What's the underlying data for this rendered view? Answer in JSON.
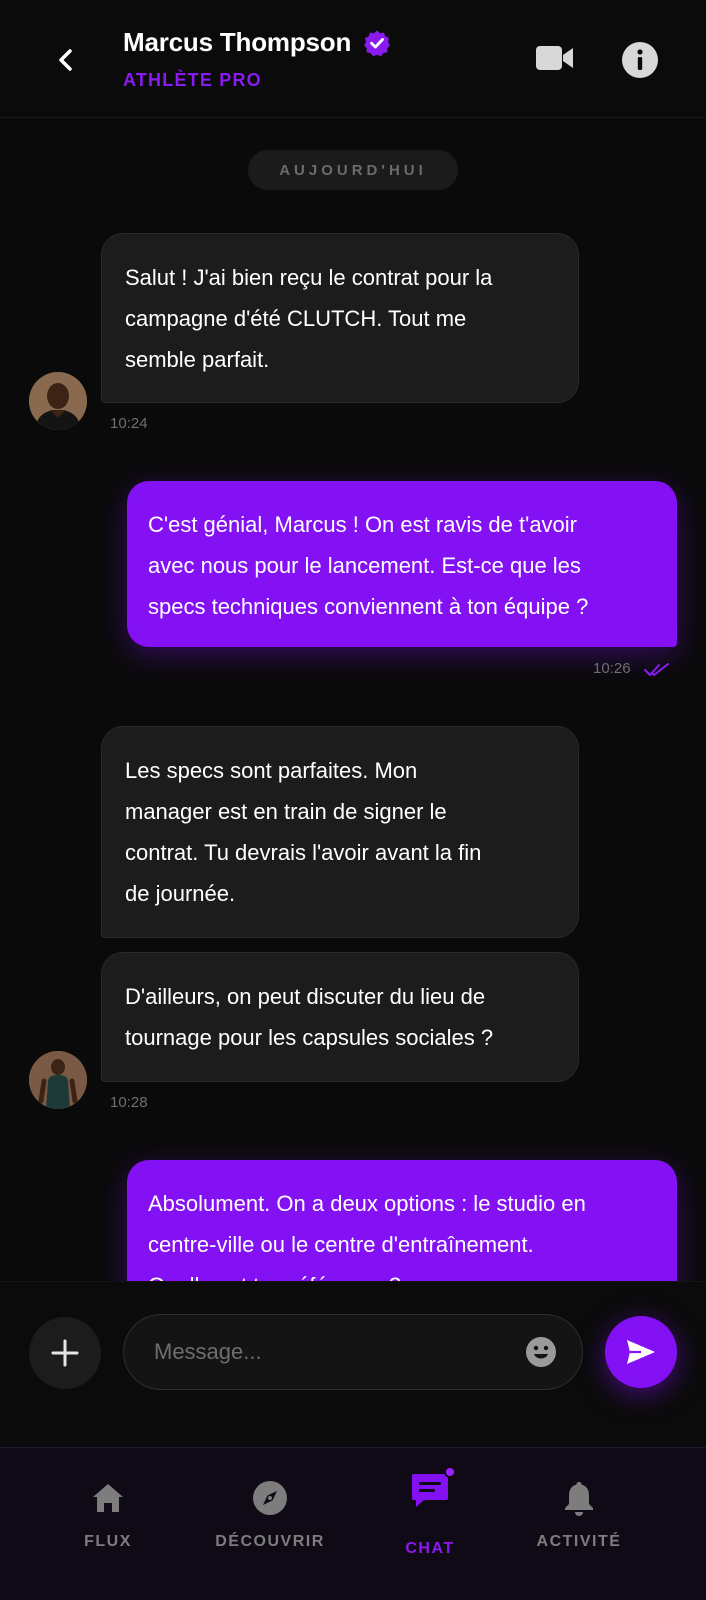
{
  "header": {
    "contact_name": "Marcus Thompson",
    "contact_role": "ATHLÈTE PRO",
    "accent_color": "#8410f4"
  },
  "chat": {
    "day_separator": "AUJOURD'HUI",
    "messages": [
      {
        "direction": "incoming",
        "lines": [
          "Salut ! J'ai bien reçu le contrat pour la",
          "campagne d'été CLUTCH. Tout me",
          "semble parfait."
        ],
        "time": "10:24"
      },
      {
        "direction": "outgoing",
        "lines": [
          "C'est génial, Marcus ! On est ravis de t'avoir",
          "avec nous pour le lancement. Est-ce que les",
          "specs techniques conviennent à ton équipe ?"
        ],
        "time": "10:26",
        "status": "read"
      },
      {
        "direction": "incoming",
        "lines": [
          "Les specs sont parfaites. Mon",
          "manager est en train de signer le",
          "contrat. Tu devrais l'avoir avant la fin",
          "de journée."
        ]
      },
      {
        "direction": "incoming",
        "lines": [
          "D'ailleurs, on peut discuter du lieu de",
          "tournage pour les capsules sociales ?"
        ],
        "time": "10:28"
      },
      {
        "direction": "outgoing",
        "lines": [
          "Absolument. On a deux options : le studio en",
          "centre-ville ou le centre d'entraînement.",
          "Quelle est ta préférence ?"
        ]
      }
    ]
  },
  "composer": {
    "placeholder": "Message...",
    "value": ""
  },
  "bottom_nav": {
    "items": [
      {
        "label": "FLUX",
        "icon": "home-icon",
        "active": false
      },
      {
        "label": "DÉCOUVRIR",
        "icon": "compass-icon",
        "active": false
      },
      {
        "label": "CHAT",
        "icon": "chat-icon",
        "active": true,
        "badge": true
      },
      {
        "label": "ACTIVITÉ",
        "icon": "bell-icon",
        "active": false
      }
    ]
  }
}
